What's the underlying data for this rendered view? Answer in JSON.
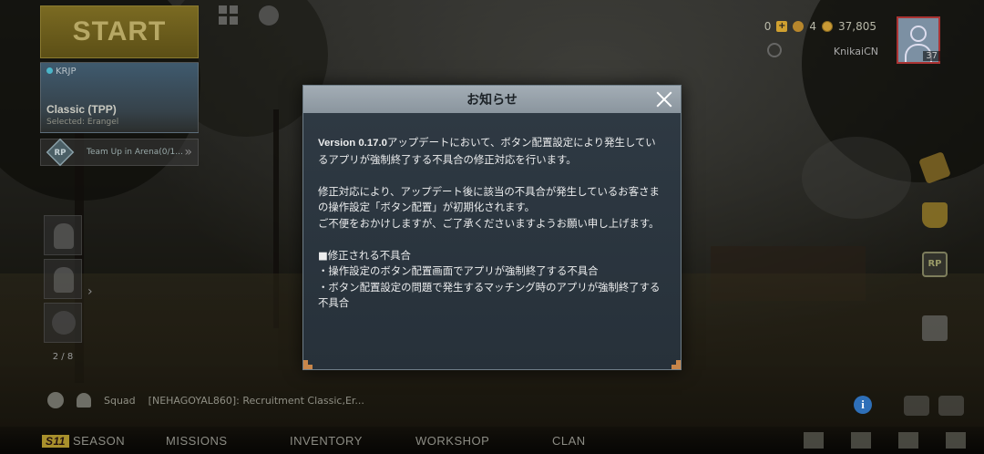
{
  "lobby": {
    "start_label": "START",
    "mode": {
      "region": "KRJP",
      "name": "Classic (TPP)",
      "map": "Selected: Erangel"
    },
    "team_up": "Team Up in Arena(0/1...",
    "rp_badge": "RP",
    "friend_count": "2 / 8"
  },
  "header": {
    "currency_a": "0",
    "currency_b": "4",
    "currency_c": "37,805",
    "player_name": "KnikaiCN",
    "level": "37"
  },
  "right_rail": {
    "rp_label": "RP"
  },
  "chat": {
    "channel": "Squad",
    "message": "[NEHAGOYAL860]: Recruitment Classic,Er..."
  },
  "nav": {
    "season_badge": "S11",
    "items": [
      "SEASON",
      "MISSIONS",
      "INVENTORY",
      "WORKSHOP",
      "CLAN"
    ]
  },
  "modal": {
    "title": "お知らせ",
    "version_prefix": "Version 0.17.0",
    "para1_rest": "アップデートにおいて、ボタン配置設定により発生しているアプリが強制終了する不具合の修正対応を行います。",
    "para2": "修正対応により、アップデート後に該当の不具合が発生しているお客さまの操作設定「ボタン配置」が初期化されます。",
    "para3": "ご不便をおかけしますが、ご了承くださいますようお願い申し上げます。",
    "list_title": "■修正される不具合",
    "bullet1": "・操作設定のボタン配置画面でアプリが強制終了する不具合",
    "bullet2": "・ボタン配置設定の問題で発生するマッチング時のアプリが強制終了する不具合"
  }
}
